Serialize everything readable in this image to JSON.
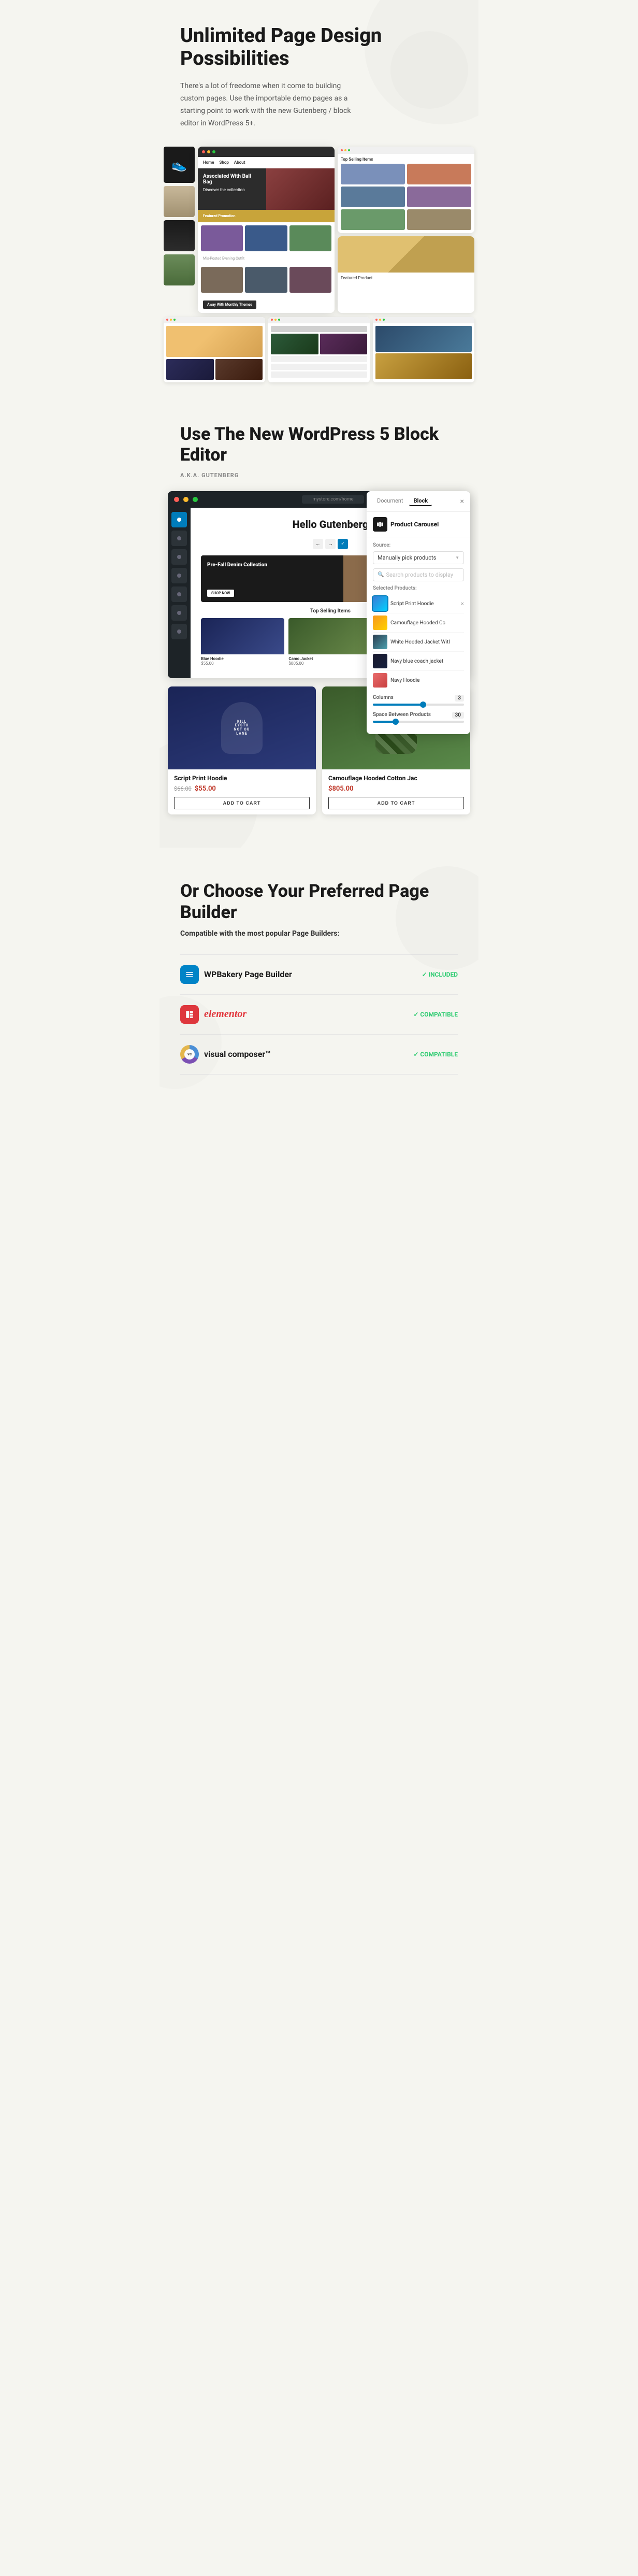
{
  "hero": {
    "title": "Unlimited Page Design Possibilities",
    "description": "There's a lot of freedome when it come to building custom pages. Use the importable demo pages as a starting point to work with the new Gutenberg / block editor in WordPress 5+."
  },
  "block_editor_section": {
    "title": "Use The New WordPress 5 Block Editor",
    "aka_label": "A.K.A. GUTENBERG",
    "editor": {
      "page_title": "Hello Gutenberg",
      "hero_text": "Pre-Fall Denim Collection",
      "hero_btn": "SHOP NOW",
      "section_title": "Top Selling Items"
    }
  },
  "block_settings_panel": {
    "tab_document": "Document",
    "tab_block": "Block",
    "close_btn": "×",
    "block_title": "Product Carousel",
    "source_label": "Source:",
    "source_value": "Manually pick products",
    "search_placeholder": "Search products to display",
    "products_label": "Selected Products:",
    "products": [
      {
        "name": "Script Print Hoodie",
        "thumb_class": "t1",
        "highlighted": true
      },
      {
        "name": "Camouflage Hooded Cc",
        "thumb_class": "t2"
      },
      {
        "name": "White Hooded Jacket Witl",
        "thumb_class": "t3"
      },
      {
        "name": "Navy blue coach jacket",
        "thumb_class": "t4"
      },
      {
        "name": "Navy Hoodie",
        "thumb_class": "t5"
      }
    ],
    "columns_label": "Columns",
    "columns_value": "3",
    "columns_fill_pct": 55,
    "space_label": "Space Between Products",
    "space_value": "30",
    "space_fill_pct": 25
  },
  "product_carousel": {
    "products": [
      {
        "name": "Script Print Hoodie",
        "old_price": "$66.00",
        "new_price": "$55.00",
        "add_to_cart": "ADD TO CART",
        "img_class": "hoodie-blue",
        "hoodie_text": "KILL\nEYSTO\nNOT OU\nLANE"
      },
      {
        "name": "Camouflage Hooded Cotton Jac",
        "old_price": null,
        "new_price": "$805.00",
        "add_to_cart": "ADD TO CART",
        "img_class": "hoodie-camo",
        "hoodie_text": null
      }
    ]
  },
  "page_builder_section": {
    "title": "Or Choose Your Preferred Page Builder",
    "subtitle": "Compatible with the most popular Page Builders:",
    "builders": [
      {
        "name": "WPBakery Page Builder",
        "badge": "INCLUDED",
        "icon_type": "wpbakery",
        "icon_letter": "W"
      },
      {
        "name": "elementor",
        "badge": "COMPATIBLE",
        "icon_type": "elementor",
        "icon_letter": "E"
      },
      {
        "name": "visual composer™",
        "badge": "COMPATIBLE",
        "icon_type": "vc",
        "icon_letter": ""
      }
    ]
  },
  "colors": {
    "accent": "#007cba",
    "danger": "#c0392b",
    "success": "#2ecc71",
    "dark": "#1a1a1a",
    "bg": "#f5f5f0"
  }
}
